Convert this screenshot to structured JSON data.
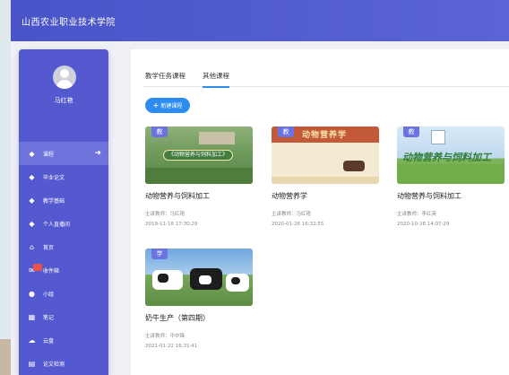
{
  "header": {
    "title": "山西农业职业技术学院"
  },
  "sidebar": {
    "username": "马红艳",
    "items": [
      {
        "label": "课程",
        "icon": "diamond-icon",
        "active": true
      },
      {
        "label": "毕业论文",
        "icon": "diamond-icon"
      },
      {
        "label": "教学基础",
        "icon": "diamond-icon"
      },
      {
        "label": "个人直播间",
        "icon": "diamond-icon"
      },
      {
        "label": "首页",
        "icon": "home-icon"
      },
      {
        "label": "收件箱",
        "icon": "mail-icon"
      },
      {
        "label": "小组",
        "icon": "user-icon"
      },
      {
        "label": "笔记",
        "icon": "note-icon"
      },
      {
        "label": "云盘",
        "icon": "cloud-icon"
      },
      {
        "label": "论文检测",
        "icon": "document-icon"
      }
    ]
  },
  "main": {
    "tabs": [
      {
        "label": "教学任务课程"
      },
      {
        "label": "其他课程",
        "active": true
      }
    ],
    "new_course_label": "新建课程",
    "courses": [
      {
        "tag": "教",
        "title": "动物营养与饲料加工",
        "teacher": "主讲教师：马红艳",
        "time": "2019-11-18 17:30:29",
        "thumb_text": "《动物营养与饲料加工》"
      },
      {
        "tag": "教",
        "title": "动物营养学",
        "teacher": "主讲教师：马红艳",
        "time": "2020-01-26 16:32:55",
        "thumb_text": "动物营养学"
      },
      {
        "tag": "教",
        "title": "动物营养与饲料加工",
        "teacher": "主讲教师：李红英",
        "time": "2020-10-28 14:07:29",
        "thumb_text": "动物营养与饲料加工"
      },
      {
        "tag": "学",
        "title": "奶牛生产（第四期）",
        "teacher": "主讲教师：牛中锋",
        "time": "2021-01-22 16:31:41"
      }
    ]
  },
  "colors": {
    "header": "#5058cc",
    "sidebar": "#5459cf",
    "accent": "#2d8cf0",
    "tag": "#6b73e0"
  }
}
